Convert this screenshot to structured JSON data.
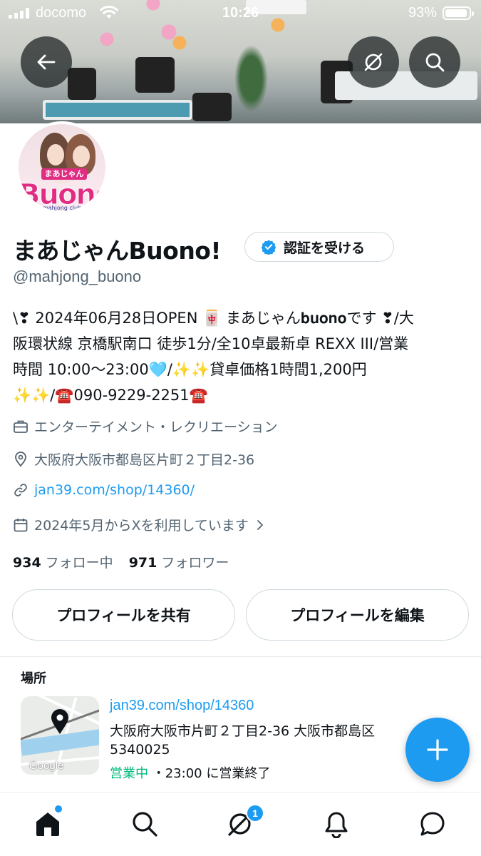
{
  "status_bar": {
    "carrier": "docomo",
    "time": "10:26",
    "battery": "93%"
  },
  "profile": {
    "name": "まあじゃんBuono!",
    "verify_label": "認証を受ける",
    "handle": "@mahjong_buono",
    "bio_lines": [
      "\\❣ 2024年06月28日OPEN 🀄 まあじゃん𝐛𝐮𝐨𝐧𝐨です ❣/大",
      "阪環状線 京橋駅南口 徒歩1分/全10卓最新卓 REXX III/営業",
      "時間 10:00～23:00🩵/✨✨貸卓価格1時間1,200円",
      "✨✨/☎️090-9229-2251☎️"
    ],
    "category": "エンターテイメント・レクリエーション",
    "location": "大阪府大阪市都島区片町２丁目2-36",
    "website": "jan39.com/shop/14360/",
    "joined": "2024年5月からXを利用しています",
    "following_count": "934",
    "following_label": "フォロー中",
    "followers_count": "971",
    "followers_label": "フォロワー"
  },
  "actions": {
    "share_label": "プロフィールを共有",
    "edit_label": "プロフィールを編集"
  },
  "location_card": {
    "title": "場所",
    "link": "jan39.com/shop/14360",
    "address": "大阪府大阪市片町２丁目2-36 大阪市都島区 5340025",
    "open_status": "営業中",
    "hours": "・23:00 に営業終了",
    "map_credit": "Google"
  },
  "tabbar": {
    "notification_count": "1"
  },
  "colors": {
    "accent": "#1d9bf0",
    "secondary_text": "#536471",
    "open_green": "#00ba7c"
  }
}
